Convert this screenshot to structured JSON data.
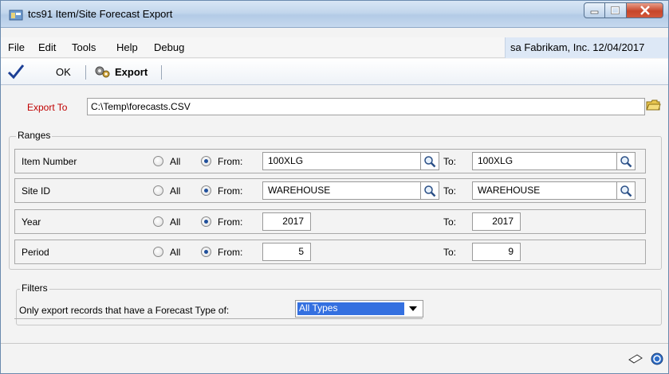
{
  "window": {
    "title": "tcs91 Item/Site Forecast Export"
  },
  "menu": {
    "items": [
      "File",
      "Edit",
      "Tools",
      "Help",
      "Debug"
    ],
    "company_info": "sa  Fabrikam, Inc.  12/04/2017"
  },
  "toolbar": {
    "ok_label": "OK",
    "export_label": "Export"
  },
  "export_to": {
    "label": "Export To",
    "path": "C:\\Temp\\forecasts.CSV"
  },
  "ranges": {
    "group_label": "Ranges",
    "all_label": "All",
    "from_label": "From:",
    "to_label": "To:",
    "rows": [
      {
        "label": "Item Number",
        "from": "100XLG",
        "to": "100XLG",
        "selected": "From"
      },
      {
        "label": "Site ID",
        "from": "WAREHOUSE",
        "to": "WAREHOUSE",
        "selected": "From"
      },
      {
        "label": "Year",
        "from": "2017",
        "to": "2017",
        "selected": "From"
      },
      {
        "label": "Period",
        "from": "5",
        "to": "9",
        "selected": "From"
      }
    ]
  },
  "filters": {
    "group_label": "Filters",
    "forecast_type_label": "Only export records that have a Forecast Type of:",
    "forecast_type_value": "All Types"
  },
  "icons": {
    "ok": "checkmark-icon",
    "export": "gears-icon",
    "folder": "folder-icon",
    "lookup": "magnifier-icon",
    "note": "note-icon",
    "help": "help-icon"
  }
}
